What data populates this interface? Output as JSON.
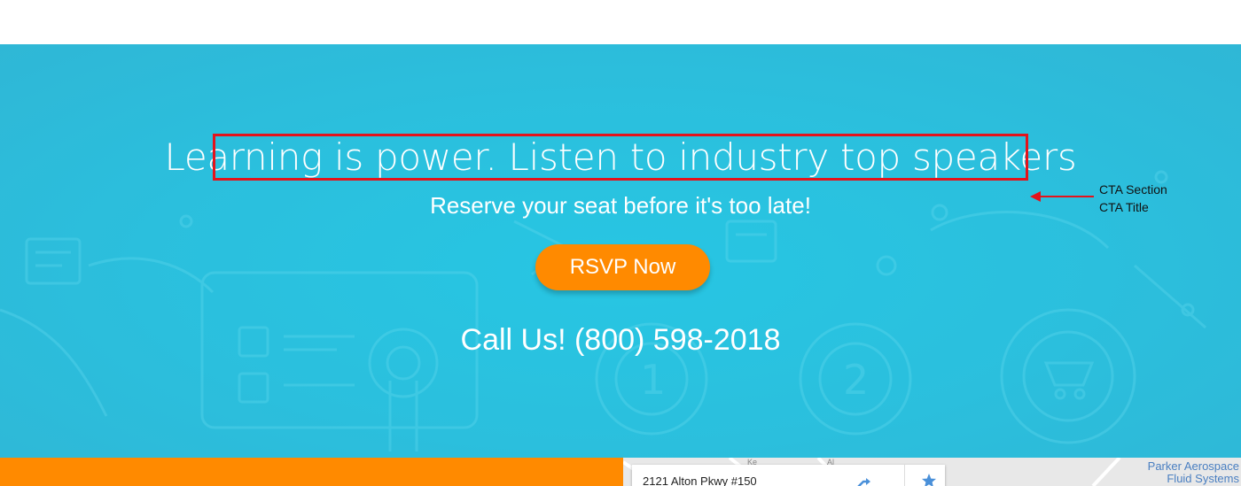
{
  "cta": {
    "title": "Learning is power. Listen to industry top speakers",
    "subtitle": "Reserve your seat before it's too late!",
    "rsvp_label": "RSVP Now",
    "call_text": "Call Us! (800) 598-2018"
  },
  "annotation": {
    "line1": "CTA Section",
    "line2": "CTA Title"
  },
  "map": {
    "address": "2121 Alton Pkwy #150",
    "place_line1": "Parker Aerospace",
    "place_line2": "Fluid Systems",
    "road_1": "Ke",
    "road_2": "Al"
  },
  "colors": {
    "cta_background": "#29c2df",
    "accent_orange": "#ff8a00",
    "highlight_red": "#e4131b",
    "map_place_blue": "#4a7fc1"
  },
  "icons": [
    "directions-icon",
    "star-icon",
    "arrow-left-icon"
  ]
}
